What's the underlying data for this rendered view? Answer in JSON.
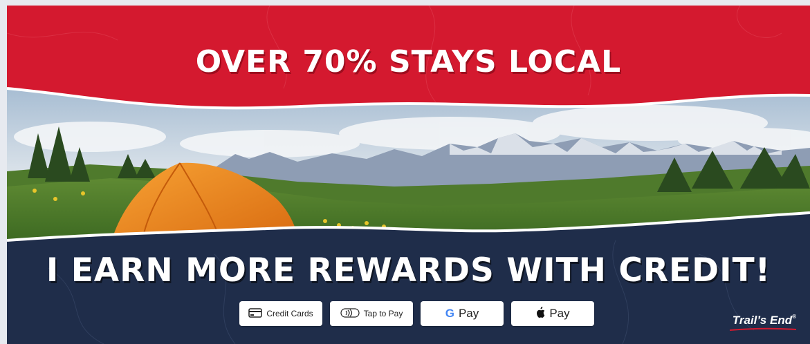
{
  "headline_top": "OVER 70% STAYS LOCAL",
  "headline_bottom": "I EARN MORE REWARDS WITH CREDIT!",
  "payment_methods": [
    {
      "label": "Credit Cards",
      "icon": "credit-card-icon"
    },
    {
      "label": "Tap to Pay",
      "icon": "contactless-icon"
    },
    {
      "label": "Pay",
      "icon": "google-g-icon"
    },
    {
      "label": "Pay",
      "icon": "apple-icon"
    }
  ],
  "brand": {
    "logo_text": "Trail’s End",
    "mark": "®"
  },
  "colors": {
    "red": "#d4192f",
    "navy": "#1f2d4a",
    "tent": "#f08a1c",
    "white": "#ffffff"
  }
}
